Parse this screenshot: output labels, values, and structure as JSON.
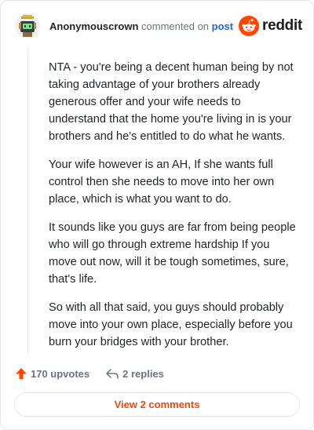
{
  "header": {
    "username": "Anonymouscrown",
    "action_text": "commented on",
    "post_link": "post",
    "logo_text": "reddit"
  },
  "comment": {
    "paragraphs": [
      "NTA - you're being a decent human being by not taking advantage of your brothers already generous offer and your wife needs to understand that the home you're living in is your brothers and he's entitled to do what he wants.",
      "Your wife however is an AH, If she wants full control then she needs to move into her own place, which is what you want to do.",
      "It sounds like you guys are far from being people who will go through extreme hardship If you move out now, will it be tough sometimes, sure, that's life.",
      "So with all that said, you guys should probably move into your own place, especially before you burn your bridges with your brother."
    ]
  },
  "actions": {
    "upvotes": "170 upvotes",
    "replies": "2 replies"
  },
  "view_comments_label": "View 2 comments",
  "colors": {
    "accent": "#e8490f",
    "link": "#2563eb",
    "reddit_orange": "#ff4500"
  },
  "icons": {
    "avatar": "snoo-avatar-icon",
    "logo": "reddit-logo-icon",
    "upvote": "upvote-arrow-icon",
    "reply": "reply-arrow-icon"
  }
}
